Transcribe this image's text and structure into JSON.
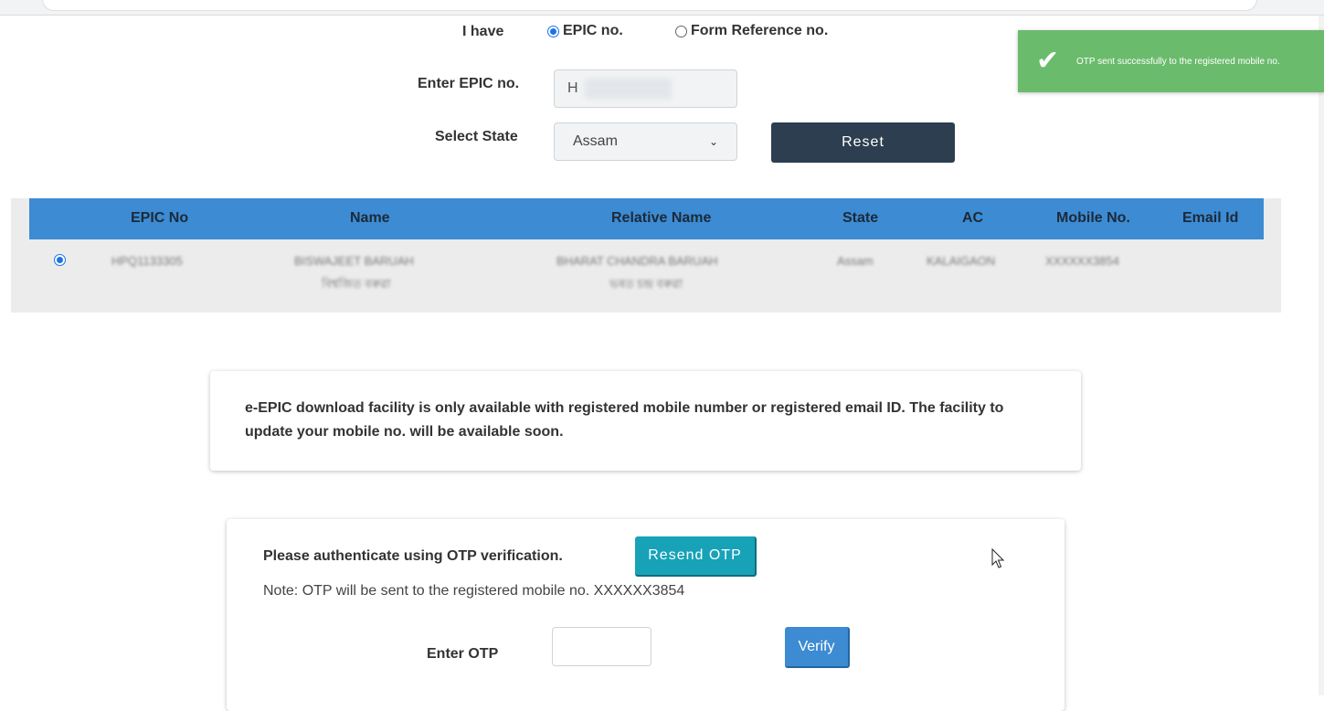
{
  "form": {
    "i_have_label": "I have",
    "radio_epic_label": "EPIC no.",
    "radio_form_ref_label": "Form Reference no.",
    "selected_option": "EPIC no.",
    "epic_label": "Enter EPIC no.",
    "epic_value": "H",
    "state_label": "Select State",
    "state_value": "Assam",
    "reset_label": "Reset"
  },
  "toast": {
    "message": "OTP sent successfully to the registered mobile no.",
    "color": "#6bbb6c",
    "icon": "check-icon"
  },
  "results": {
    "headers": [
      "EPIC No",
      "Name",
      "Relative Name",
      "State",
      "AC",
      "Mobile No.",
      "Email Id"
    ],
    "header_color": "#3d8bd2",
    "row": {
      "selected": true,
      "epic_no": "HPQ1133305",
      "name": "BISWAJEET BARUAH",
      "name_local": "বিশ্বজিত বৰুৱা",
      "relative_name": "BHARAT CHANDRA BARUAH",
      "relative_name_local": "ভৰত চন্দ্ৰ বৰুৱা",
      "state": "Assam",
      "ac": "KALAIGAON",
      "mobile": "XXXXXX3854",
      "email": ""
    }
  },
  "info": {
    "text": "e-EPIC download facility is only available with registered mobile number or registered email ID. The facility to update your mobile no. will be available soon."
  },
  "otp": {
    "title": "Please authenticate using OTP verification.",
    "resend_label": "Resend OTP",
    "note": "Note: OTP will be sent to the registered mobile no. XXXXXX3854",
    "enter_label": "Enter OTP",
    "input_value": "",
    "verify_label": "Verify"
  }
}
